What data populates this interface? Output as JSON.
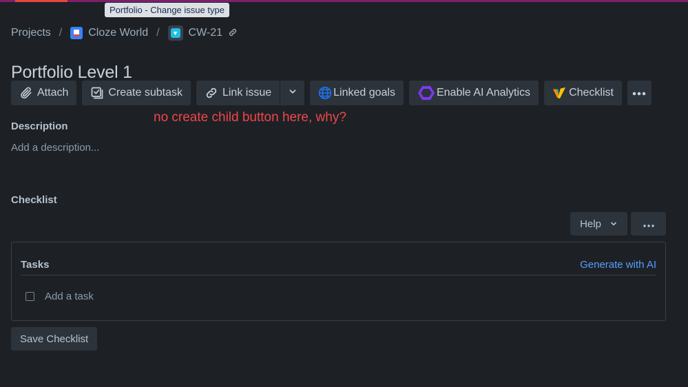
{
  "tooltip": {
    "text": "Portfolio - Change issue type"
  },
  "breadcrumb": {
    "projects": "Projects",
    "separator": "/",
    "project": "Cloze World",
    "issue_key": "CW-21"
  },
  "issue": {
    "title": "Portfolio Level 1"
  },
  "toolbar": {
    "attach": "Attach",
    "create_subtask": "Create subtask",
    "link_issue": "Link issue",
    "linked_goals": "Linked goals",
    "enable_ai_analytics": "Enable AI Analytics",
    "checklist": "Checklist"
  },
  "annotation": {
    "text": "no create child button here, why?"
  },
  "description": {
    "label": "Description",
    "placeholder": "Add a description..."
  },
  "checklist": {
    "label": "Checklist",
    "help": "Help",
    "tasks_title": "Tasks",
    "generate_ai": "Generate with AI",
    "add_task": "Add a task",
    "save": "Save Checklist"
  },
  "colors": {
    "background": "#1d2125",
    "button": "#2c333a",
    "annotation": "#f0464a",
    "link": "#579dff",
    "top_bar": "#7d1f6e"
  }
}
